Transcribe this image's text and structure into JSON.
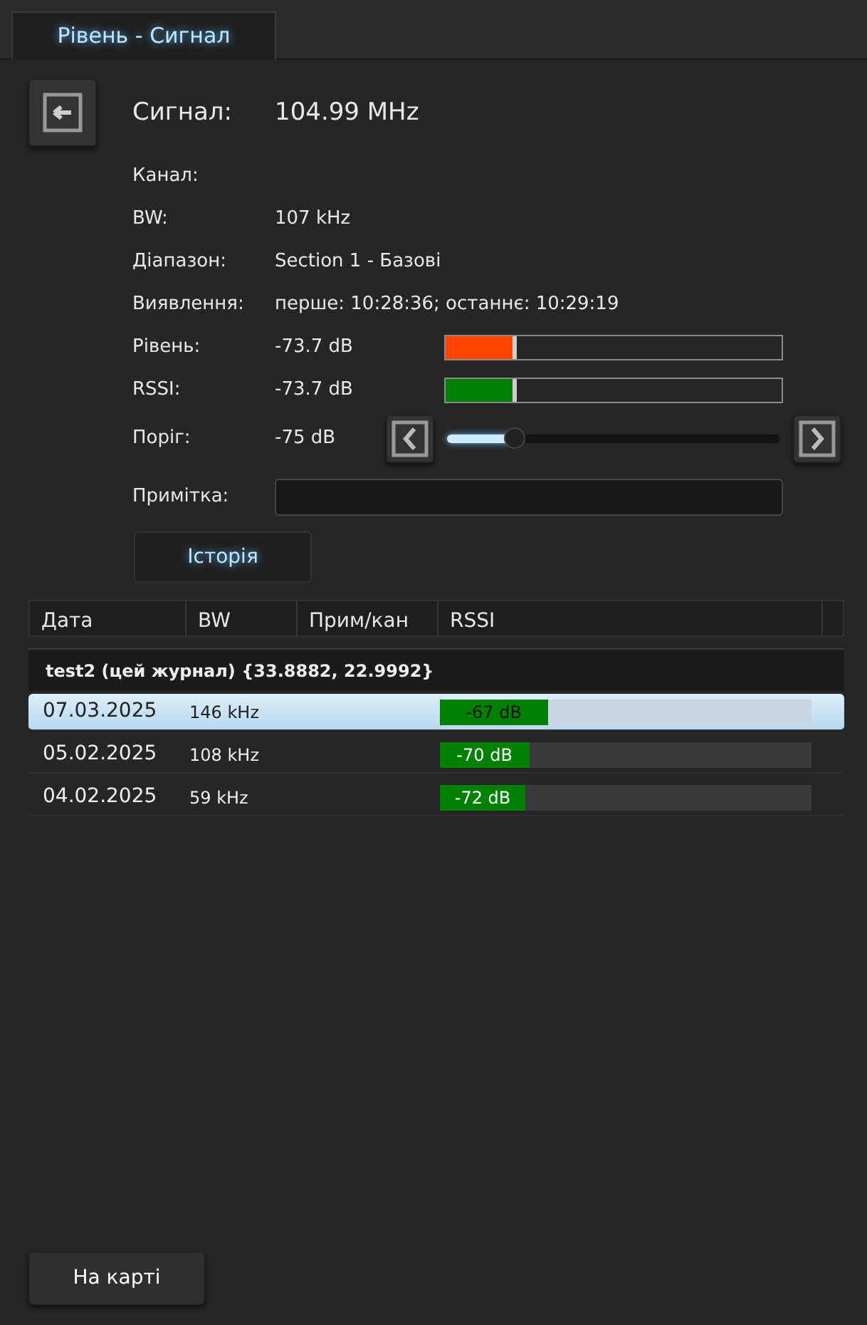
{
  "tab": {
    "label": "Рівень - Сигнал",
    "selected": true
  },
  "signal": {
    "label": "Сигнал:",
    "value": "104.99 MHz"
  },
  "fields": [
    {
      "kind": "text",
      "label": "Канал:"
    },
    {
      "kind": "text",
      "label": "BW:",
      "value": "107 kHz"
    },
    {
      "kind": "text",
      "label": "Діапазон:",
      "value": "Section 1 - Базові"
    },
    {
      "kind": "text",
      "label": "Виявлення:",
      "value": "перше: 10:28:36; останнє: 10:29:19"
    },
    {
      "kind": "meter",
      "label": "Рівень:",
      "value": "-73.7 dB",
      "level": 0.21,
      "color": "#ff4500"
    },
    {
      "kind": "meter",
      "label": "RSSI:",
      "value": "-73.7 dB",
      "level": 0.21,
      "color": "#008000"
    },
    {
      "kind": "slider",
      "label": "Поріг:",
      "value": "-75 dB",
      "level": 0.2
    },
    {
      "kind": "input",
      "label": "Примітка:"
    }
  ],
  "history_button": "Історія",
  "table": {
    "columns": [
      "Дата",
      "BW",
      "Прим/кан",
      "RSSI"
    ],
    "group": "test2 (цей журнал) {33.8882, 22.9992}",
    "rows": [
      {
        "date": "07.03.2025",
        "bw": "146 kHz",
        "rssi": "-67 dB",
        "level": 0.29,
        "selected": true
      },
      {
        "date": "05.02.2025",
        "bw": "108 kHz",
        "rssi": "-70 dB",
        "level": 0.24,
        "selected": false
      },
      {
        "date": "04.02.2025",
        "bw": "59 kHz",
        "rssi": "-72 dB",
        "level": 0.23,
        "selected": false
      }
    ]
  },
  "map_button": "На карті"
}
